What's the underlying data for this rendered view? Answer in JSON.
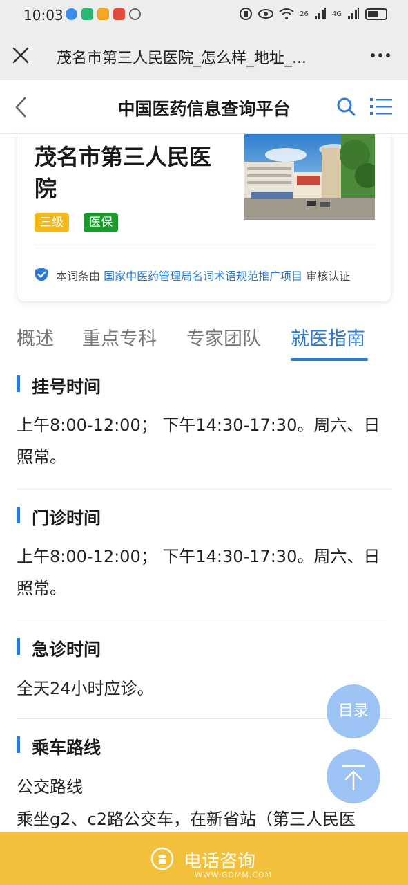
{
  "status_bar": {
    "time": "10:03",
    "app_dots": [
      "#3a8ee6",
      "#2bb673",
      "#f5a623",
      "#e64a3a"
    ],
    "signal_left": "26",
    "signal_right": "4G"
  },
  "browser": {
    "title": "茂名市第三人民医院_怎么样_地址_..."
  },
  "site": {
    "title": "中国医药信息查询平台"
  },
  "hospital": {
    "name": "茂名市第三人民医院",
    "badge_level": "三级",
    "badge_insurance": "医保",
    "verify_prefix": "本词条由",
    "verify_link": "国家中医药管理局名词术语规范推广项目",
    "verify_suffix": "审核认证"
  },
  "tabs": [
    {
      "label": "概述"
    },
    {
      "label": "重点专科"
    },
    {
      "label": "专家团队"
    },
    {
      "label": "就医指南"
    }
  ],
  "sections": [
    {
      "title": "挂号时间",
      "text": "上午8:00-12:00； 下午14:30-17:30。周六、日照常。"
    },
    {
      "title": "门诊时间",
      "text": "上午8:00-12:00； 下午14:30-17:30。周六、日照常。"
    },
    {
      "title": "急诊时间",
      "text": "全天24小时应诊。"
    },
    {
      "title": "乘车路线",
      "text": "公交路线",
      "text2": "乘坐g2、c2路公交车，在新省站（第三人民医"
    }
  ],
  "fab": {
    "toc_label": "目录"
  },
  "bottom": {
    "label": "电话咨询",
    "watermark": "WWW.GDMM.COM"
  },
  "colors": {
    "accent": "#2b7bd6",
    "badge_level": "#f5b81c",
    "badge_insurance": "#1c9a2e",
    "bottom_bar": "#f2c03a",
    "fab": "#9cc3f3"
  }
}
